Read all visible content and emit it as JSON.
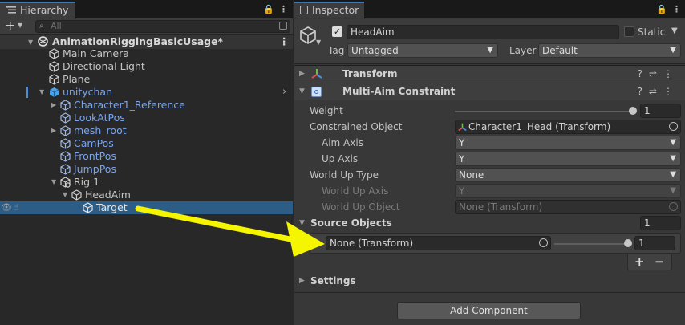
{
  "hierarchy": {
    "tab_label": "Hierarchy",
    "add_label": "+",
    "search_placeholder": "All",
    "scene_name": "AnimationRiggingBasicUsage*",
    "items": [
      {
        "label": "Main Camera"
      },
      {
        "label": "Directional Light"
      },
      {
        "label": "Plane"
      },
      {
        "label": "unitychan"
      },
      {
        "label": "Character1_Reference"
      },
      {
        "label": "LookAtPos"
      },
      {
        "label": "mesh_root"
      },
      {
        "label": "CamPos"
      },
      {
        "label": "FrontPos"
      },
      {
        "label": "JumpPos"
      },
      {
        "label": "Rig 1"
      },
      {
        "label": "HeadAim"
      },
      {
        "label": "Target"
      }
    ]
  },
  "inspector": {
    "tab_label": "Inspector",
    "object_name": "HeadAim",
    "static_label": "Static",
    "tag_label": "Tag",
    "tag_value": "Untagged",
    "layer_label": "Layer",
    "layer_value": "Default",
    "transform_title": "Transform",
    "constraint_title": "Multi-Aim Constraint",
    "weight_label": "Weight",
    "weight_value": "1",
    "constrained_label": "Constrained Object",
    "constrained_value": "Character1_Head (Transform)",
    "aim_axis_label": "Aim Axis",
    "aim_axis_value": "Y",
    "up_axis_label": "Up Axis",
    "up_axis_value": "Y",
    "world_up_type_label": "World Up Type",
    "world_up_type_value": "None",
    "world_up_axis_label": "World Up Axis",
    "world_up_axis_value": "Y",
    "world_up_object_label": "World Up Object",
    "world_up_object_value": "None (Transform)",
    "source_objects_label": "Source Objects",
    "source_objects_count": "1",
    "source_item_value": "None (Transform)",
    "source_item_weight": "1",
    "add_element": "+",
    "remove_element": "−",
    "settings_label": "Settings",
    "add_component_label": "Add Component"
  },
  "colors": {
    "selection": "#2c5d87",
    "annotation_arrow": "#f5f500",
    "prefab_blue": "#7ba4e8"
  }
}
